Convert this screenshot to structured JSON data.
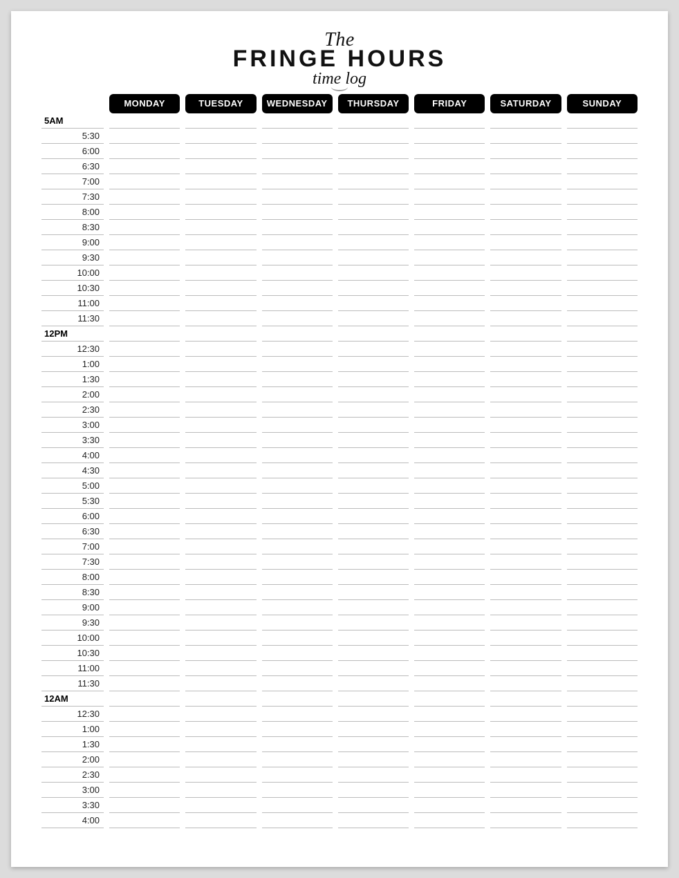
{
  "header": {
    "line1": "The",
    "line2": "FRINGE HOURS",
    "line3": "time log"
  },
  "days": [
    "MONDAY",
    "TUESDAY",
    "WEDNESDAY",
    "THURSDAY",
    "FRIDAY",
    "SATURDAY",
    "SUNDAY"
  ],
  "times": [
    {
      "label": "5AM",
      "bold": true
    },
    {
      "label": "5:30",
      "bold": false
    },
    {
      "label": "6:00",
      "bold": false
    },
    {
      "label": "6:30",
      "bold": false
    },
    {
      "label": "7:00",
      "bold": false
    },
    {
      "label": "7:30",
      "bold": false
    },
    {
      "label": "8:00",
      "bold": false
    },
    {
      "label": "8:30",
      "bold": false
    },
    {
      "label": "9:00",
      "bold": false
    },
    {
      "label": "9:30",
      "bold": false
    },
    {
      "label": "10:00",
      "bold": false
    },
    {
      "label": "10:30",
      "bold": false
    },
    {
      "label": "11:00",
      "bold": false
    },
    {
      "label": "11:30",
      "bold": false
    },
    {
      "label": "12PM",
      "bold": true
    },
    {
      "label": "12:30",
      "bold": false
    },
    {
      "label": "1:00",
      "bold": false
    },
    {
      "label": "1:30",
      "bold": false
    },
    {
      "label": "2:00",
      "bold": false
    },
    {
      "label": "2:30",
      "bold": false
    },
    {
      "label": "3:00",
      "bold": false
    },
    {
      "label": "3:30",
      "bold": false
    },
    {
      "label": "4:00",
      "bold": false
    },
    {
      "label": "4:30",
      "bold": false
    },
    {
      "label": "5:00",
      "bold": false
    },
    {
      "label": "5:30",
      "bold": false
    },
    {
      "label": "6:00",
      "bold": false
    },
    {
      "label": "6:30",
      "bold": false
    },
    {
      "label": "7:00",
      "bold": false
    },
    {
      "label": "7:30",
      "bold": false
    },
    {
      "label": "8:00",
      "bold": false
    },
    {
      "label": "8:30",
      "bold": false
    },
    {
      "label": "9:00",
      "bold": false
    },
    {
      "label": "9:30",
      "bold": false
    },
    {
      "label": "10:00",
      "bold": false
    },
    {
      "label": "10:30",
      "bold": false
    },
    {
      "label": "11:00",
      "bold": false
    },
    {
      "label": "11:30",
      "bold": false
    },
    {
      "label": "12AM",
      "bold": true
    },
    {
      "label": "12:30",
      "bold": false
    },
    {
      "label": "1:00",
      "bold": false
    },
    {
      "label": "1:30",
      "bold": false
    },
    {
      "label": "2:00",
      "bold": false
    },
    {
      "label": "2:30",
      "bold": false
    },
    {
      "label": "3:00",
      "bold": false
    },
    {
      "label": "3:30",
      "bold": false
    },
    {
      "label": "4:00",
      "bold": false
    }
  ]
}
